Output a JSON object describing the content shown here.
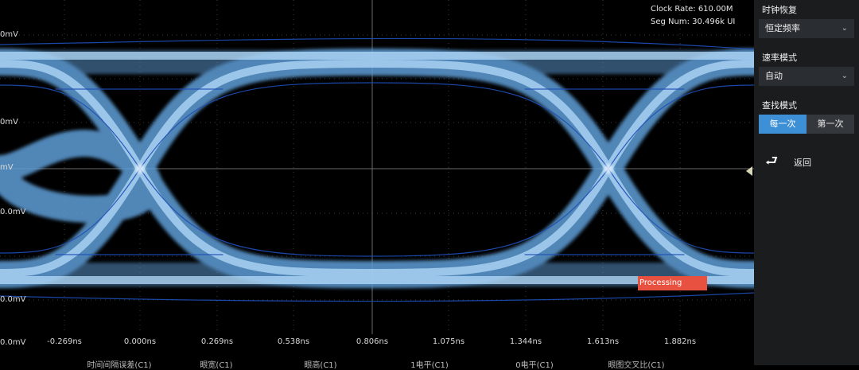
{
  "info": {
    "clock_rate": "Clock Rate: 610.00M",
    "seg_num": "Seg Num: 30.496k UI"
  },
  "y_labels": [
    "0mV",
    "0mV",
    "mV",
    "0.0mV",
    "0.0mV",
    "0.0mV"
  ],
  "x_labels": [
    "-0.269ns",
    "0.000ns",
    "0.269ns",
    "0.538ns",
    "0.806ns",
    "1.075ns",
    "1.344ns",
    "1.613ns",
    "1.882ns"
  ],
  "measurements": [
    "时间间隔误差(C1)",
    "眼宽(C1)",
    "眼高(C1)",
    "1电平(C1)",
    "0电平(C1)",
    "眼图交叉比(C1)"
  ],
  "processing_label": "Processing",
  "sidebar": {
    "clock_recovery_label": "时钟恢复",
    "clock_recovery_value": "恒定频率",
    "rate_mode_label": "速率模式",
    "rate_mode_value": "自动",
    "search_mode_label": "查找模式",
    "search_mode_options": [
      "每一次",
      "第一次"
    ],
    "search_mode_selected": "每一次",
    "back_label": "返回"
  },
  "colors": {
    "accent": "#3d8fd6",
    "trace": "#a8d2f4",
    "processing": "#e8503f",
    "panel": "#1b1c1e"
  }
}
